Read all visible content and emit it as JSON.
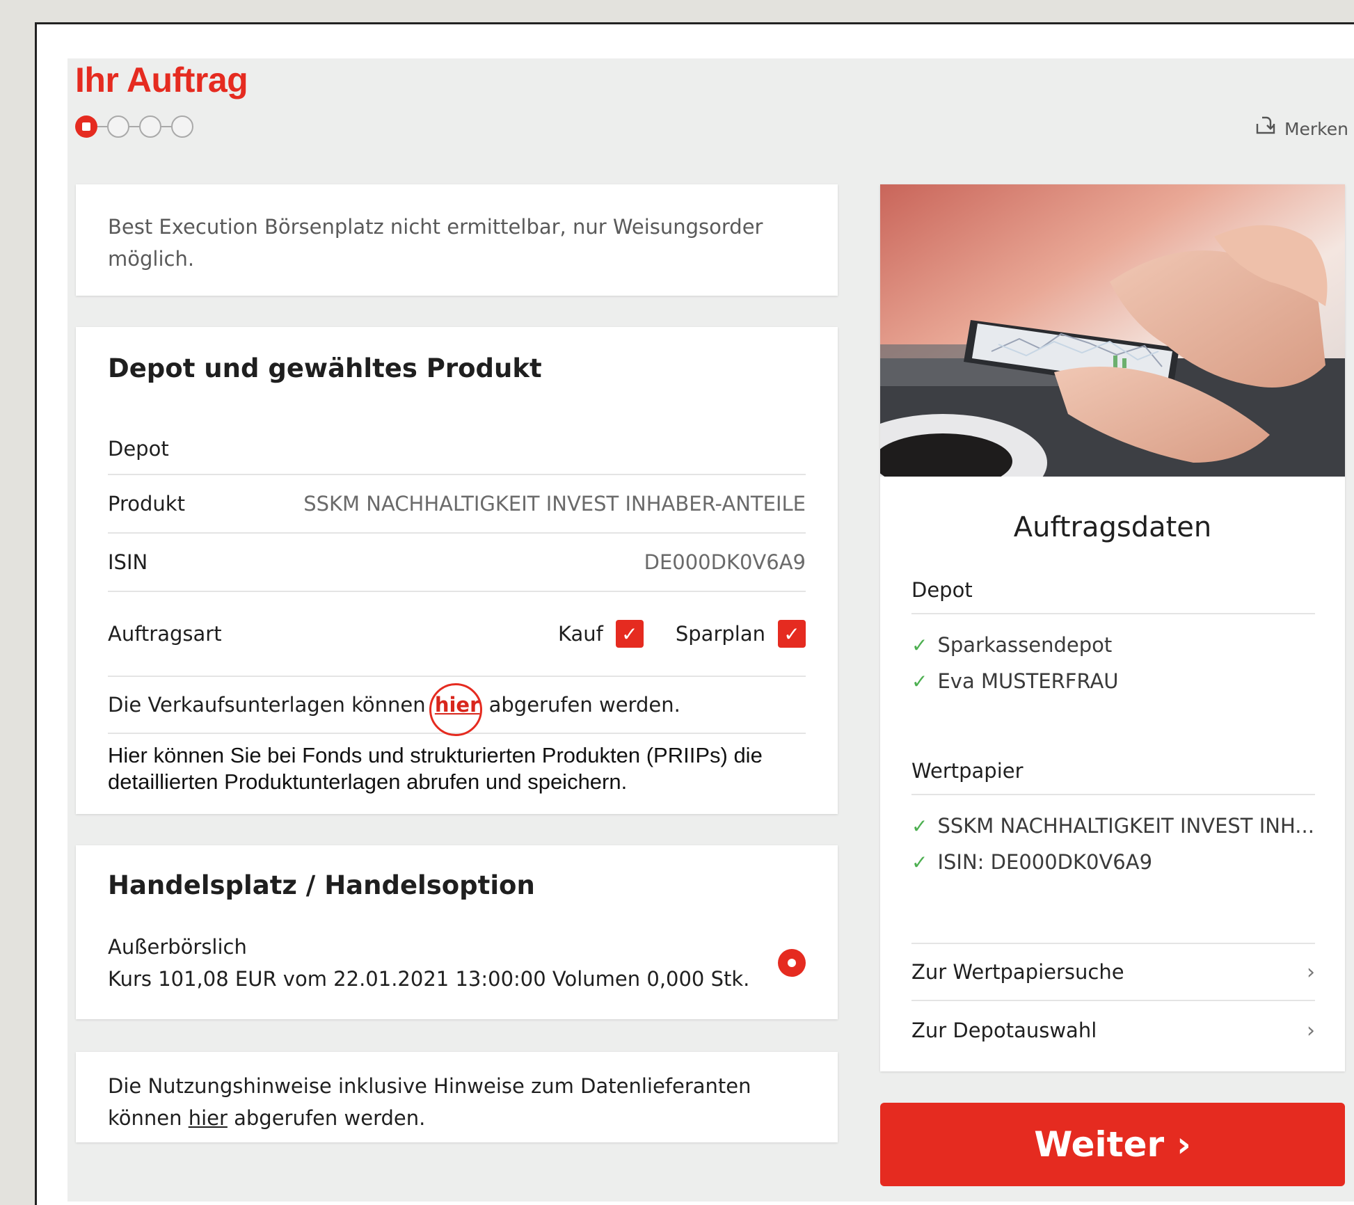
{
  "header": {
    "title": "Ihr Auftrag",
    "steps": 4,
    "active_step": 1,
    "merken_label": "Merken"
  },
  "notice": {
    "text": "Best Execution Börsenplatz nicht ermittelbar, nur Weisungsorder möglich."
  },
  "product_card": {
    "title": "Depot und gewähltes Produkt",
    "depot_label": "Depot",
    "depot_value": "",
    "produkt_label": "Produkt",
    "produkt_value": "SSKM NACHHALTIGKEIT INVEST INHABER-ANTEILE",
    "isin_label": "ISIN",
    "isin_value": "DE000DK0V6A9",
    "auftragsart_label": "Auftragsart",
    "kauf_label": "Kauf",
    "kauf_checked": true,
    "sparplan_label": "Sparplan",
    "sparplan_checked": true,
    "verkauf_prefix": "Die Verkaufsunterlagen können",
    "verkauf_link": "hier",
    "verkauf_suffix": "abgerufen werden.",
    "priips_text": "Hier können Sie bei Fonds und strukturierten Produkten (PRIIPs) die detaillierten Produktunterlagen abrufen und speichern."
  },
  "handel_card": {
    "title": "Handelsplatz / Handelsoption",
    "option_name": "Außerbörslich",
    "option_detail": "Kurs 101,08 EUR vom 22.01.2021 13:00:00 Volumen 0,000 Stk.",
    "selected": true
  },
  "nutzung_card": {
    "line1": "Die Nutzungshinweise inklusive Hinweise zum Datenlieferanten",
    "prefix": "können",
    "link": "hier",
    "suffix": "abgerufen werden."
  },
  "sidebar": {
    "title": "Auftragsdaten",
    "depot_head": "Depot",
    "depot_items": [
      "Sparkassendepot",
      "Eva MUSTERFRAU"
    ],
    "wertpapier_head": "Wertpapier",
    "wertpapier_items": [
      "SSKM NACHHALTIGKEIT INVEST INH...",
      "ISIN: DE000DK0V6A9"
    ],
    "nav": [
      "Zur Wertpapiersuche",
      "Zur Depotauswahl"
    ]
  },
  "cta": {
    "label": "Weiter"
  },
  "colors": {
    "brand_red": "#e52b20",
    "check_green": "#4caf50",
    "background": "#edeeed"
  }
}
